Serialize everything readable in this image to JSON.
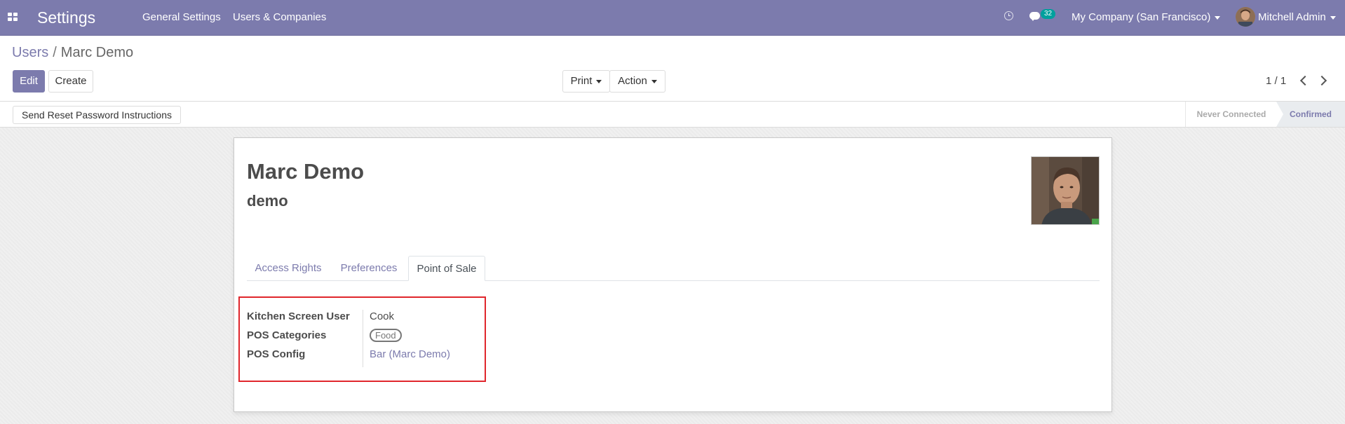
{
  "navbar": {
    "app_title": "Settings",
    "menu": [
      "General Settings",
      "Users & Companies"
    ],
    "chat_count": "32",
    "company": "My Company (San Francisco)",
    "user": "Mitchell Admin",
    "color": "#7c7bad"
  },
  "breadcrumb": {
    "parent": "Users",
    "separator": "/",
    "current": "Marc Demo"
  },
  "buttons": {
    "edit": "Edit",
    "create": "Create",
    "print": "Print",
    "action": "Action"
  },
  "pager": {
    "value": "1 / 1"
  },
  "statusbar": {
    "reset_button": "Send Reset Password Instructions",
    "stages": [
      "Never Connected",
      "Confirmed"
    ],
    "current_stage": "Confirmed"
  },
  "form": {
    "name": "Marc Demo",
    "login": "demo",
    "tabs": [
      "Access Rights",
      "Preferences",
      "Point of Sale"
    ],
    "active_tab": "Point of Sale",
    "fields": {
      "kitchen_screen_user": {
        "label": "Kitchen Screen User",
        "value": "Cook"
      },
      "pos_categories": {
        "label": "POS Categories",
        "tags": [
          "Food"
        ]
      },
      "pos_config": {
        "label": "POS Config",
        "value": "Bar (Marc Demo)"
      }
    }
  }
}
